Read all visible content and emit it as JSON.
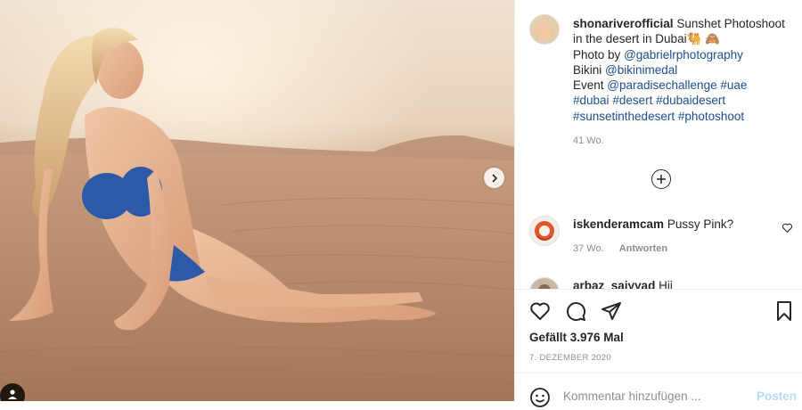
{
  "post": {
    "username": "shonariverofficial",
    "caption_text": "Sunshet Photoshoot in the desert in Dubai",
    "caption_emojis": "🐫 🙈",
    "photo_by_label": "Photo by",
    "photo_by_handle": "@gabrielrphotography",
    "bikini_label": "Bikini",
    "bikini_handle": "@bikinimedal",
    "event_label": "Event",
    "event_handle": "@paradisechallenge",
    "hashtags": [
      "#uae",
      "#dubai",
      "#desert",
      "#dubaidesert",
      "#sunsetinthedesert",
      "#photoshoot"
    ],
    "caption_age": "41 Wo."
  },
  "comments": [
    {
      "username": "iskenderamcam",
      "text": "Pussy Pink?",
      "age": "37 Wo.",
      "reply_label": "Antworten"
    },
    {
      "username": "arbaz_saiyyad",
      "text": "Hii"
    }
  ],
  "stats": {
    "likes": "Gefällt 3.976 Mal",
    "date": "7. Dezember 2020"
  },
  "add_comment": {
    "placeholder": "Kommentar hinzufügen ...",
    "post_label": "Posten"
  },
  "icons": {
    "like": "heart-icon",
    "comment": "comment-bubble-icon",
    "share": "paper-plane-icon",
    "save": "bookmark-icon",
    "next": "chevron-right-icon",
    "load_more": "plus-circle-icon",
    "emoji": "smiley-icon",
    "tagged_users": "user-tag-icon"
  },
  "colors": {
    "link": "#1d4f91",
    "muted": "#8e8e8e",
    "post_button_disabled": "#b3dbff",
    "text": "#262626"
  }
}
